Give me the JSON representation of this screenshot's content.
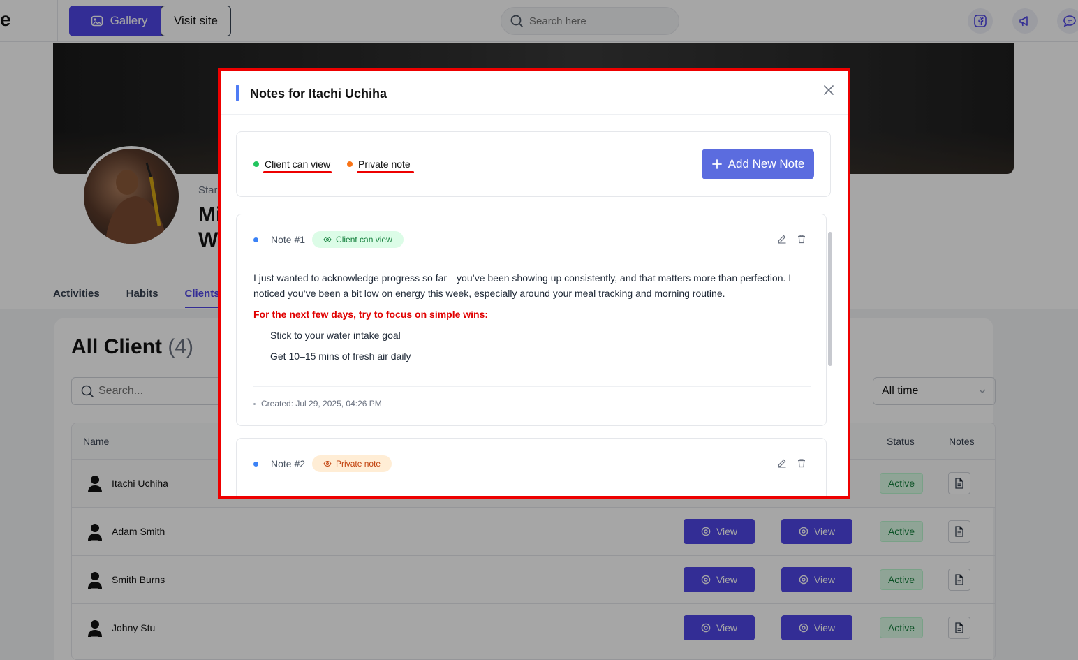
{
  "topbar": {
    "logo_fragment": "e",
    "gallery_label": "Gallery",
    "visit_label": "Visit site",
    "search_placeholder": "Search here"
  },
  "profile": {
    "subtitle_fragment": "Star",
    "name_fragment_1": "Mi",
    "name_fragment_2": "W"
  },
  "tabs": [
    {
      "label": "Activities"
    },
    {
      "label": "Habits"
    },
    {
      "label": "Clients"
    }
  ],
  "clients": {
    "title": "All Client",
    "count": "(4)",
    "search_placeholder": "Search...",
    "filter_value": "All time",
    "columns": {
      "name": "Name",
      "status": "Status",
      "notes": "Notes"
    },
    "view_label": "View",
    "rows": [
      {
        "name": "Itachi Uchiha",
        "status": "Active"
      },
      {
        "name": "Adam Smith",
        "status": "Active"
      },
      {
        "name": "Smith Burns",
        "status": "Active"
      },
      {
        "name": "Johny Stu",
        "status": "Active"
      }
    ]
  },
  "modal": {
    "title": "Notes for Itachi Uchiha",
    "legend_client": "Client can view",
    "legend_private": "Private note",
    "add_label": "Add New Note",
    "notes": [
      {
        "label": "Note #1",
        "visibility": "Client can view",
        "body": "I just wanted to acknowledge progress so far—you’ve been showing up consistently, and that matters more than perfection. I noticed you’ve been a bit low on energy this week, especially around your meal tracking and morning routine.",
        "focus": "For the next few days, try to focus on simple wins:",
        "items": [
          "Stick to your water intake goal",
          "Get 10–15 mins of fresh air daily"
        ],
        "created": "Created: Jul 29, 2025, 04:26 PM"
      },
      {
        "label": "Note #2",
        "visibility": "Private note"
      }
    ]
  },
  "colors": {
    "accent": "#4f46e5",
    "client_view": "#22c55e",
    "private": "#f97316",
    "highlight": "#ee0000"
  }
}
